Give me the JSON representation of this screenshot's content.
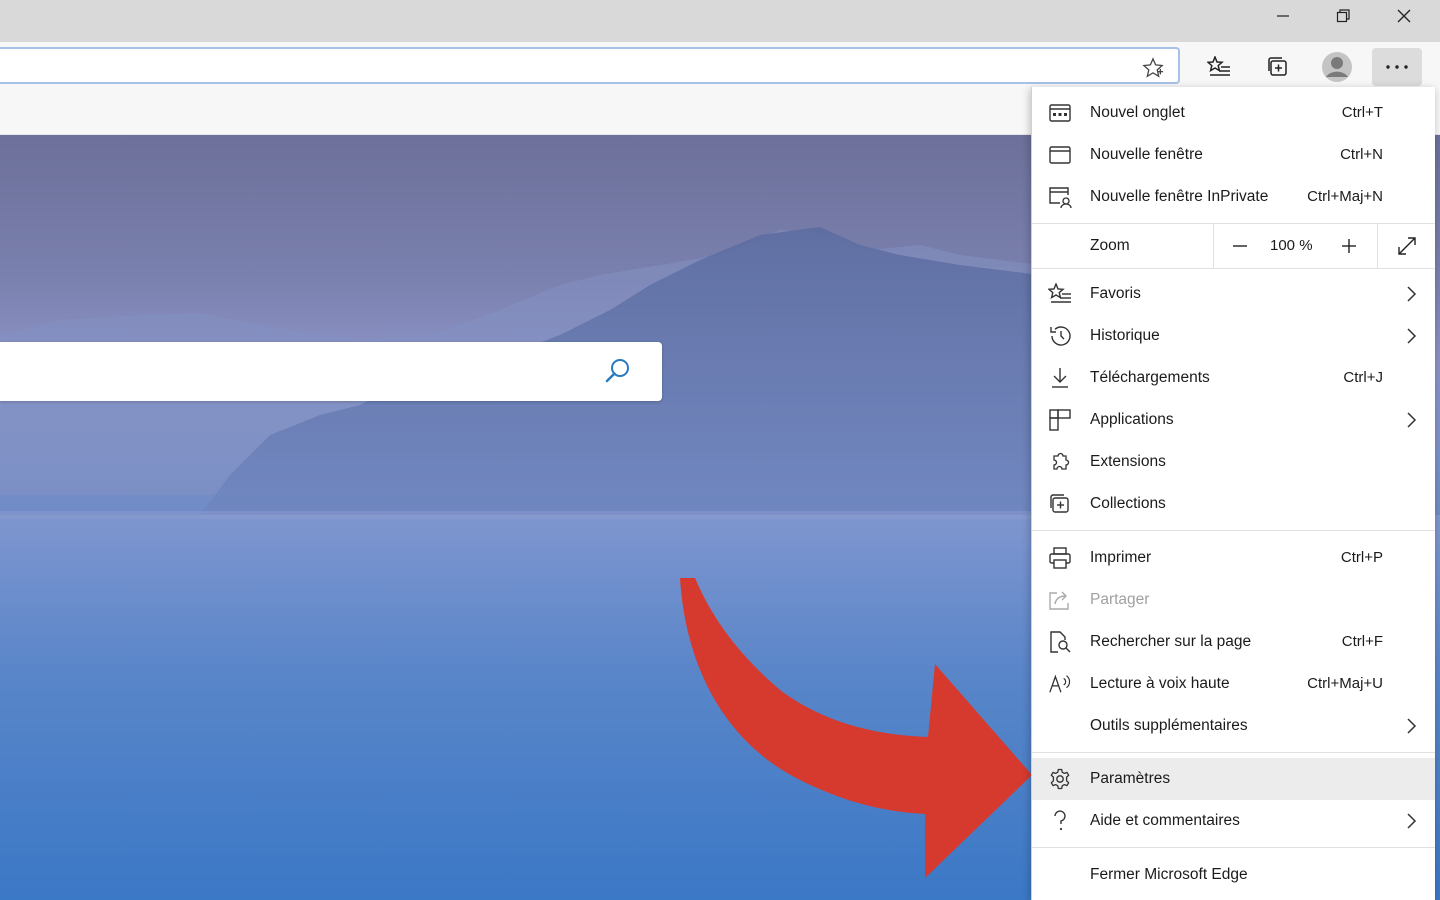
{
  "window": {
    "minimize_icon": "minimize-icon",
    "restore_icon": "restore-icon",
    "close_icon": "close-icon"
  },
  "toolbar": {
    "favorite_star_icon": "add-favorite-star-icon",
    "favorites_icon": "favorites-icon",
    "collections_icon": "collections-icon",
    "profile_icon": "profile-avatar-icon",
    "more_icon": "more-ellipsis-icon"
  },
  "menu": {
    "items": [
      {
        "label": "Nouvel onglet",
        "shortcut": "Ctrl+T",
        "icon": "new-tab-icon"
      },
      {
        "label": "Nouvelle fenêtre",
        "shortcut": "Ctrl+N",
        "icon": "new-window-icon"
      },
      {
        "label": "Nouvelle fenêtre InPrivate",
        "shortcut": "Ctrl+Maj+N",
        "icon": "inprivate-window-icon"
      }
    ],
    "zoom": {
      "label": "Zoom",
      "value": "100 %",
      "minus": "−",
      "plus": "+"
    },
    "group2": [
      {
        "label": "Favoris",
        "shortcut": "",
        "icon": "favorites-icon",
        "submenu": true
      },
      {
        "label": "Historique",
        "shortcut": "",
        "icon": "history-icon",
        "submenu": true
      },
      {
        "label": "Téléchargements",
        "shortcut": "Ctrl+J",
        "icon": "download-icon",
        "submenu": false
      },
      {
        "label": "Applications",
        "shortcut": "",
        "icon": "apps-icon",
        "submenu": true
      },
      {
        "label": "Extensions",
        "shortcut": "",
        "icon": "extensions-icon",
        "submenu": false
      },
      {
        "label": "Collections",
        "shortcut": "",
        "icon": "collections-icon",
        "submenu": false
      }
    ],
    "group3": [
      {
        "label": "Imprimer",
        "shortcut": "Ctrl+P",
        "icon": "print-icon",
        "submenu": false,
        "disabled": false
      },
      {
        "label": "Partager",
        "shortcut": "",
        "icon": "share-icon",
        "submenu": false,
        "disabled": true
      },
      {
        "label": "Rechercher sur la page",
        "shortcut": "Ctrl+F",
        "icon": "find-on-page-icon",
        "submenu": false,
        "disabled": false
      },
      {
        "label": "Lecture à voix haute",
        "shortcut": "Ctrl+Maj+U",
        "icon": "read-aloud-icon",
        "submenu": false,
        "disabled": false
      },
      {
        "label": "Outils supplémentaires",
        "shortcut": "",
        "icon": "",
        "submenu": true,
        "disabled": false
      }
    ],
    "group4": [
      {
        "label": "Paramètres",
        "icon": "settings-gear-icon",
        "submenu": false,
        "highlighted": true
      },
      {
        "label": "Aide et commentaires",
        "icon": "help-icon",
        "submenu": true,
        "highlighted": false
      }
    ],
    "close": {
      "label": "Fermer Microsoft Edge"
    }
  },
  "page": {
    "search_icon": "search-magnifier-icon",
    "annotation": "red-arrow-pointer"
  },
  "colors": {
    "annotation_arrow": "#d63a2f",
    "address_focus_border": "#a7c2e8",
    "search_icon": "#2a7ac0"
  }
}
